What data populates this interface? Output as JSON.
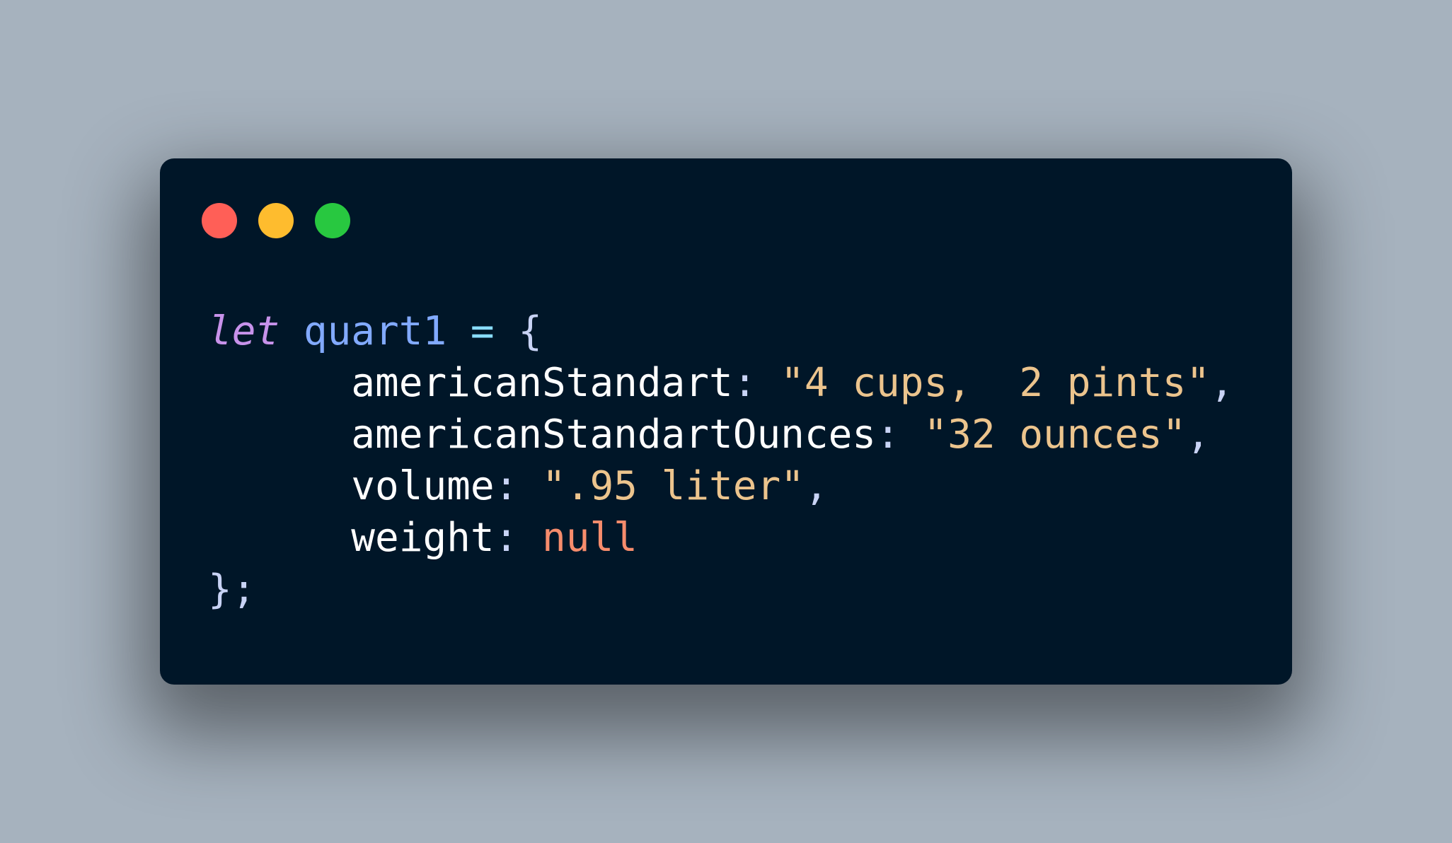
{
  "window": {
    "controls": [
      {
        "name": "close-control",
        "color": "#ff5f57"
      },
      {
        "name": "minimize-control",
        "color": "#febc2e"
      },
      {
        "name": "maximize-control",
        "color": "#28c840"
      }
    ]
  },
  "colors": {
    "page_background": "#a6b2be",
    "editor_background": "#001628",
    "keyword": "#c792ea",
    "variable": "#82aaff",
    "operator": "#89ddff",
    "punctuation": "#c8d3f5",
    "property": "#ffffff",
    "string": "#ecc48d",
    "null": "#f78c6c"
  },
  "code": {
    "lines": [
      {
        "indent": "",
        "tokens": [
          {
            "type": "keyword",
            "text": "let"
          },
          {
            "type": "plain",
            "text": " "
          },
          {
            "type": "variable",
            "text": "quart1"
          },
          {
            "type": "plain",
            "text": " "
          },
          {
            "type": "operator",
            "text": "="
          },
          {
            "type": "plain",
            "text": " "
          },
          {
            "type": "punctuation",
            "text": "{"
          }
        ]
      },
      {
        "indent": "      ",
        "tokens": [
          {
            "type": "property",
            "text": "americanStandart"
          },
          {
            "type": "punctuation",
            "text": ":"
          },
          {
            "type": "plain",
            "text": " "
          },
          {
            "type": "string",
            "text": "\"4 cups,  2 pints\""
          },
          {
            "type": "punctuation",
            "text": ","
          }
        ]
      },
      {
        "indent": "      ",
        "tokens": [
          {
            "type": "property",
            "text": "americanStandartOunces"
          },
          {
            "type": "punctuation",
            "text": ":"
          },
          {
            "type": "plain",
            "text": " "
          },
          {
            "type": "string",
            "text": "\"32 ounces\""
          },
          {
            "type": "punctuation",
            "text": ","
          }
        ]
      },
      {
        "indent": "      ",
        "tokens": [
          {
            "type": "property",
            "text": "volume"
          },
          {
            "type": "punctuation",
            "text": ":"
          },
          {
            "type": "plain",
            "text": " "
          },
          {
            "type": "string",
            "text": "\".95 liter\""
          },
          {
            "type": "punctuation",
            "text": ","
          }
        ]
      },
      {
        "indent": "      ",
        "tokens": [
          {
            "type": "property",
            "text": "weight"
          },
          {
            "type": "punctuation",
            "text": ":"
          },
          {
            "type": "plain",
            "text": " "
          },
          {
            "type": "null",
            "text": "null"
          }
        ]
      },
      {
        "indent": "",
        "tokens": [
          {
            "type": "punctuation",
            "text": "};"
          }
        ]
      }
    ]
  }
}
